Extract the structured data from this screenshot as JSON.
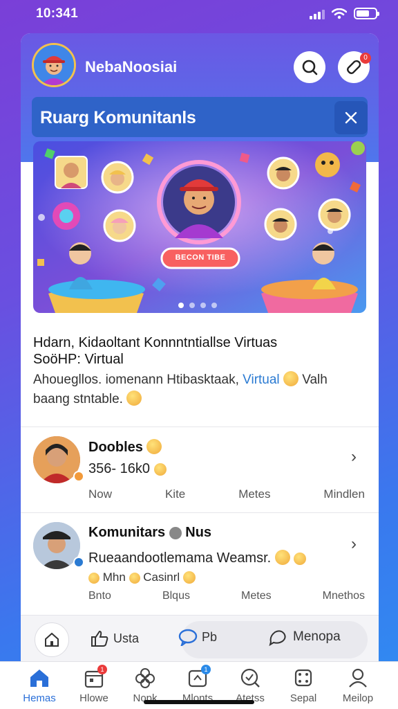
{
  "status_bar": {
    "time": "10:341",
    "battery_level": 0.7
  },
  "header": {
    "app_name": "NebaNoosiai",
    "search_icon": "search-icon",
    "notification_icon": "notification-icon",
    "notification_count": "0"
  },
  "banner": {
    "title": "Ruarg Komunitanls"
  },
  "hero": {
    "sign_text": "BECON TIBE",
    "page_count": 4,
    "active_page": 0
  },
  "post": {
    "title_line1": "Hdarn, Kidaoltant Konnntntiallse Virtuas",
    "title_line2": "SoöHP: Virtual",
    "body_pre": "Ahouegllos. iomenann Htibasktaak,",
    "body_link": "Virtual",
    "body_post": "Valh",
    "body_line2": "baang stntable."
  },
  "feed": [
    {
      "name": "Doobles",
      "subtitle": "356- 16k0",
      "actions": [
        "Now",
        "Kite",
        "Metes",
        "Mindlen"
      ]
    },
    {
      "name": "Komunitars",
      "name_suffix": "Nus",
      "subtitle": "Rueaandootlemama Weamsr.",
      "subtitle2_a": "Mhn",
      "subtitle2_b": "Casinrl",
      "actions": [
        "Bnto",
        "Blqus",
        "Metes",
        "Mnethos"
      ]
    }
  ],
  "bottom_actions": {
    "like_label": "Usta",
    "comment_label": "Pb",
    "menu_label": "Menopa"
  },
  "tabs": [
    {
      "label": "Hemas",
      "icon": "home-icon",
      "active": true
    },
    {
      "label": "Hlowe",
      "icon": "calendar-icon",
      "badge": "1"
    },
    {
      "label": "Nopk",
      "icon": "flower-icon"
    },
    {
      "label": "Mlonts",
      "icon": "share-icon",
      "badge": "1"
    },
    {
      "label": "Atetss",
      "icon": "search-check-icon"
    },
    {
      "label": "Sepal",
      "icon": "dice-icon"
    },
    {
      "label": "Meilop",
      "icon": "user-icon"
    }
  ],
  "colors": {
    "accent": "#2a6fd8",
    "header": "#5a6ae8",
    "banner": "#2f63c8",
    "badge": "#ea3b3b"
  }
}
